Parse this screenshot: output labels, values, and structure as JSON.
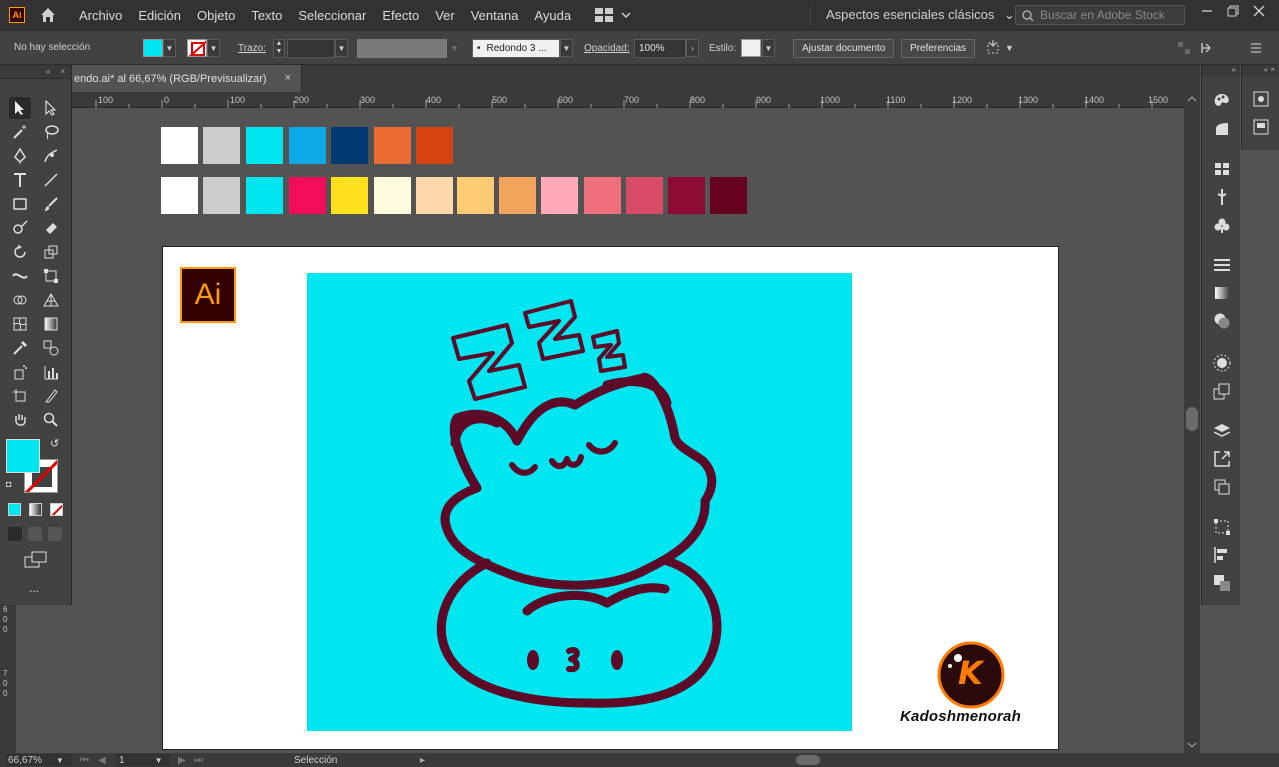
{
  "menubar": {
    "app_icon": "Ai",
    "items": [
      "Archivo",
      "Edición",
      "Objeto",
      "Texto",
      "Seleccionar",
      "Efecto",
      "Ver",
      "Ventana",
      "Ayuda"
    ],
    "workspace": "Aspectos esenciales clásicos",
    "stock_placeholder": "Buscar en Adobe Stock"
  },
  "controlbar": {
    "selection": "No hay selección",
    "fill_color": "#00e6f0",
    "stroke_label": "Trazo:",
    "brush": "Redondo 3 ...",
    "opacity_label": "Opacidad:",
    "opacity_value": "100%",
    "style_label": "Estilo:",
    "ajustar_button": "Ajustar documento",
    "preferencias_button": "Preferencias"
  },
  "document": {
    "tab_title": "endo.ai* al 66,67% (RGB/Previsualizar)",
    "close": "×"
  },
  "ruler": {
    "ticks": [
      "100",
      "0",
      "100",
      "200",
      "300",
      "400",
      "500",
      "600",
      "700",
      "800",
      "900",
      "1000",
      "1100",
      "1200",
      "1300",
      "1400",
      "1500"
    ],
    "vticks": [
      "6",
      "0",
      "0",
      "7",
      "0",
      "0"
    ]
  },
  "swatches": {
    "row1": [
      "#ffffff",
      "#cccccc",
      "#00e6f0",
      "#0fa8e8",
      "#003a70",
      "#eb6b34",
      "#d54410"
    ],
    "row2": [
      "#ffffff",
      "#cccccc",
      "#00e6f0",
      "#f20d5c",
      "#ffe01a",
      "#fffbdf",
      "#fdd8ab",
      "#fdcb74",
      "#f2a35c",
      "#ffa9ba",
      "#f06f7c",
      "#d84b67",
      "#8c0c33",
      "#65031e"
    ]
  },
  "artwork": {
    "logo_text": "Ai",
    "brand_letter": "K",
    "brand_name": "Kadoshmenorah",
    "stroke_color": "#5c0a27",
    "background_color": "#00e6f0"
  },
  "toolbar": {
    "fill_color": "#00e6f0",
    "more": "..."
  },
  "statusbar": {
    "zoom": "66,67%",
    "page": "1",
    "tool": "Selección"
  }
}
